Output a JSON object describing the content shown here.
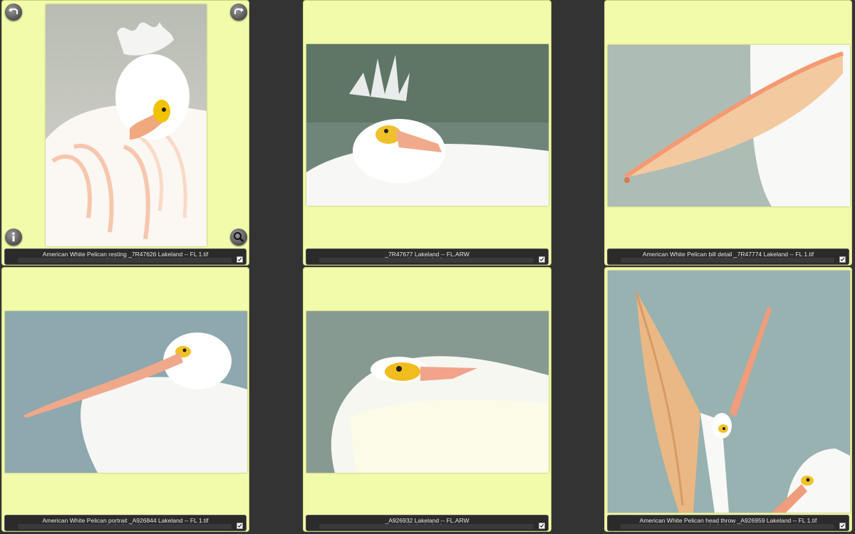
{
  "thumbnails": [
    {
      "caption": "American White Pelican resting _7R47626  Lakeland -- FL 1.tif",
      "checked": true
    },
    {
      "caption": "_7R47677  Lakeland -- FL.ARW",
      "checked": true
    },
    {
      "caption": "American White Pelican bill detail _7R47774  Lakeland -- FL 1.tif",
      "checked": true
    },
    {
      "caption": "American White Pelican portrait _A926844  Lakeland -- FL 1.tif",
      "checked": true
    },
    {
      "caption": "_A926932  Lakeland -- FL.ARW",
      "checked": true
    },
    {
      "caption": "American White Pelican head throw _A926959  Lakeland -- FL 1.tif",
      "checked": true
    }
  ],
  "rating_dots": "• • • • •",
  "icons": {
    "rotate_left": "rotate-left-icon",
    "rotate_right": "rotate-right-icon",
    "info": "info-icon",
    "magnify": "magnifier-icon",
    "checkmark": "checkmark-icon"
  },
  "colors": {
    "background": "#333333",
    "cell": "#f2fbaa",
    "caption_bar": "#2b2b2b"
  }
}
